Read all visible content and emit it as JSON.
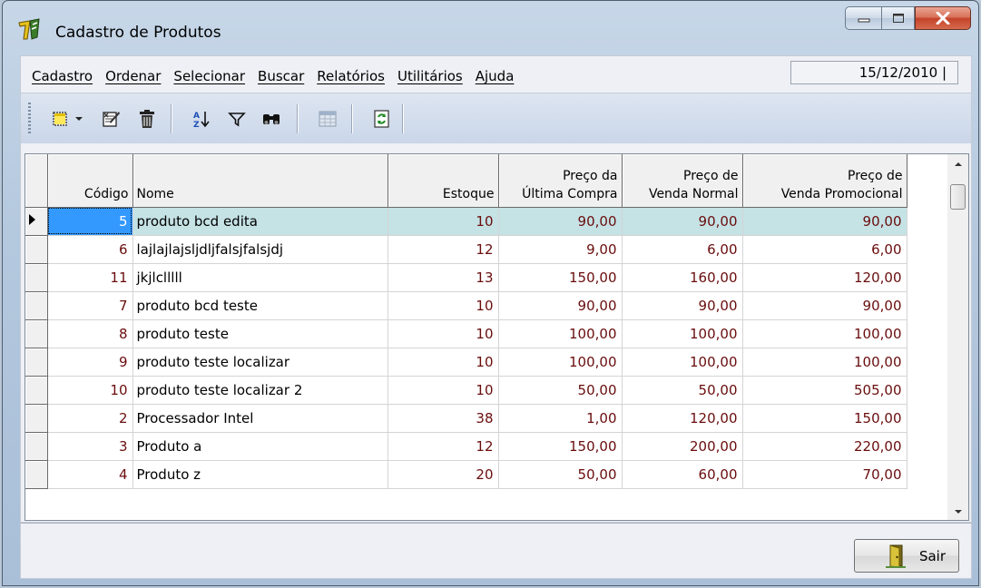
{
  "window": {
    "title": "Cadastro de Produtos",
    "accent": "#c4432a"
  },
  "menu": {
    "items": [
      {
        "label": "Cadastro"
      },
      {
        "label": "Ordenar"
      },
      {
        "label": "Selecionar"
      },
      {
        "label": "Buscar"
      },
      {
        "label": "Relatórios"
      },
      {
        "label": "Utilitários"
      },
      {
        "label": "Ajuda"
      }
    ],
    "date": "15/12/2010 |"
  },
  "toolbar": {
    "icons": [
      "new-record-icon",
      "dropdown-arrow-icon",
      "edit-record-icon",
      "delete-icon",
      "sort-az-icon",
      "filter-icon",
      "binoculars-search-icon",
      "report-table-icon",
      "refresh-icon"
    ]
  },
  "grid": {
    "headers": {
      "codigo": "Código",
      "nome": "Nome",
      "estoque": "Estoque",
      "preco_compra_1": "Preço da",
      "preco_compra_2": "Última Compra",
      "preco_venda_1": "Preço de",
      "preco_venda_2": "Venda Normal",
      "preco_promo_1": "Preço de",
      "preco_promo_2": "Venda Promocional"
    },
    "rows": [
      {
        "codigo": "5",
        "nome": "produto bcd edita",
        "estoque": "10",
        "compra": "90,00",
        "venda": "90,00",
        "promo": "90,00"
      },
      {
        "codigo": "6",
        "nome": "lajlajlajsljdljfalsjfalsjdj",
        "estoque": "12",
        "compra": "9,00",
        "venda": "6,00",
        "promo": "6,00"
      },
      {
        "codigo": "11",
        "nome": "jkjlclllll",
        "estoque": "13",
        "compra": "150,00",
        "venda": "160,00",
        "promo": "120,00"
      },
      {
        "codigo": "7",
        "nome": "produto bcd teste",
        "estoque": "10",
        "compra": "90,00",
        "venda": "90,00",
        "promo": "90,00"
      },
      {
        "codigo": "8",
        "nome": "produto teste",
        "estoque": "10",
        "compra": "100,00",
        "venda": "100,00",
        "promo": "100,00"
      },
      {
        "codigo": "9",
        "nome": "produto teste localizar",
        "estoque": "10",
        "compra": "100,00",
        "venda": "100,00",
        "promo": "100,00"
      },
      {
        "codigo": "10",
        "nome": "produto teste localizar 2",
        "estoque": "10",
        "compra": "50,00",
        "venda": "50,00",
        "promo": "505,00"
      },
      {
        "codigo": "2",
        "nome": "Processador Intel",
        "estoque": "38",
        "compra": "1,00",
        "venda": "120,00",
        "promo": "150,00"
      },
      {
        "codigo": "3",
        "nome": "Produto a",
        "estoque": "12",
        "compra": "150,00",
        "venda": "200,00",
        "promo": "220,00"
      },
      {
        "codigo": "4",
        "nome": "Produto z",
        "estoque": "20",
        "compra": "50,00",
        "venda": "60,00",
        "promo": "70,00"
      }
    ]
  },
  "footer": {
    "sair_label": "Sair"
  }
}
